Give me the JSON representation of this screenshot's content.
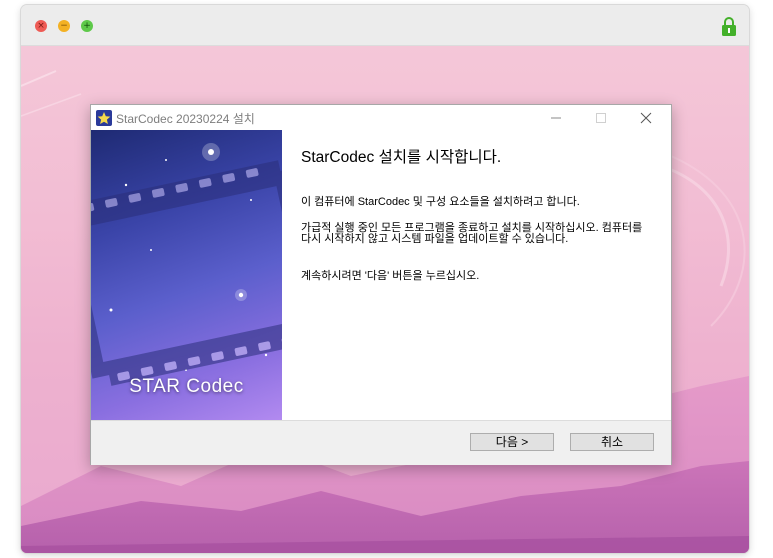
{
  "installer": {
    "title": "StarCodec 20230224 설치",
    "banner_text": "STAR Codec",
    "heading": "StarCodec 설치를 시작합니다.",
    "paragraph1": "이 컴퓨터에 StarCodec 및 구성 요소들을 설치하려고 합니다.",
    "paragraph2": "가급적 실행 중인 모든 프로그램을 종료하고 설치를 시작하십시오. 컴퓨터를 다시 시작하지 않고 시스템 파일을 업데이트할 수 있습니다.",
    "paragraph3": "계속하시려면 '다음' 버튼을 누르십시오.",
    "next_button": "다음 >",
    "cancel_button": "취소"
  },
  "icons": {
    "close": "close-icon",
    "minimize": "minimize-icon",
    "maximize": "maximize-icon",
    "lock": "lock-icon",
    "app": "star-icon"
  },
  "colors": {
    "lock": "#43b02a",
    "traffic_red": "#ee5b55",
    "traffic_yellow": "#f3b124",
    "traffic_green": "#5ec94a",
    "banner_dark": "#1e2a73",
    "banner_light": "#b28af0"
  }
}
